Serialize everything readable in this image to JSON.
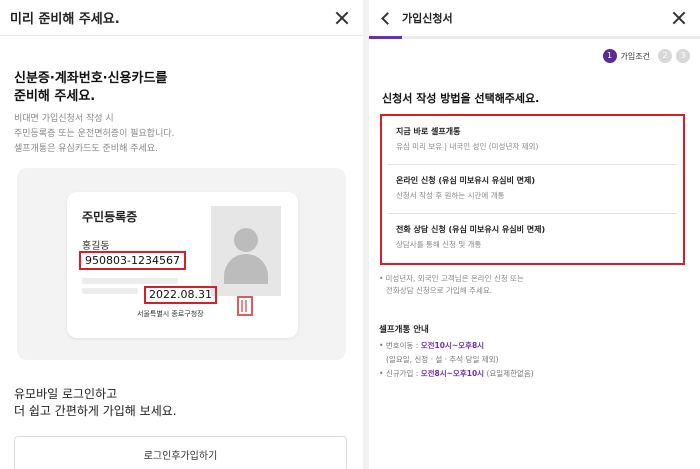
{
  "left": {
    "header_title": "미리 준비해 주세요.",
    "heading_line1": "신분증·계좌번호·신용카드를",
    "heading_line2": "준비해 주세요.",
    "desc_line1": "비대면 가입신청서 작성 시",
    "desc_line2": "주민등록증 또는 운전면허증이 필요합니다.",
    "desc_line3": "셀프개통은 유심카드도 준비해 주세요.",
    "id_card": {
      "title": "주민등록증",
      "name": "홍길동",
      "rrn": "950803-1234567",
      "issue_date": "2022.08.31",
      "issuer": "서울특별시 종로구청장"
    },
    "login_line1": "유모바일 로그인하고",
    "login_line2": "더 쉽고 간편하게 가입해 보세요.",
    "login_button": "로그인후가입하기"
  },
  "right": {
    "header_title": "가입신청서",
    "progress": 0.1,
    "steps": {
      "step1": "1",
      "step1_label": "가입조건",
      "step2": "2",
      "step3": "3"
    },
    "heading": "신청서 작성 방법을 선택해주세요.",
    "options": [
      {
        "name": "지금 바로 셀프개통",
        "sub": "유심 미리 보유 | 내국인 성인 (미성년자 제외)"
      },
      {
        "name": "온라인 신청 (유심 미보유시 유심비 면제)",
        "sub": "신청서 작성 후 원하는 시간에 개통"
      },
      {
        "name": "전화 상담 신청 (유심 미보유시 유심비 면제)",
        "sub": "상담사를 통해 신청 및 개통"
      }
    ],
    "notice_line1": "미성년자, 외국인 고객님은 온라인 신청 또는",
    "notice_line2": "전화상담 신청으로 가입해 주세요.",
    "guide_title": "셀프개통 안내",
    "guide": {
      "line1_prefix": "번호이동 : ",
      "line1_hours": "오전10시~오후8시",
      "line2": "(일요일, 신정 · 설 · 추석 당일 제외)",
      "line3_prefix": "신규가입 : ",
      "line3_hours": "오전8시~오후10시",
      "line3_suffix": " (요일제한없음)"
    }
  }
}
